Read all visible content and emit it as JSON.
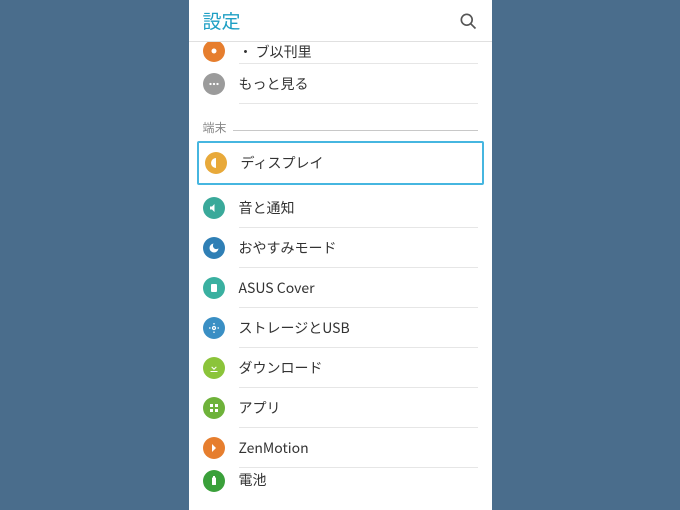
{
  "header": {
    "title": "設定"
  },
  "partialTop": {
    "label": "・  ブ以刊里",
    "iconColor": "#e67e2e"
  },
  "preSection": {
    "more": {
      "label": "もっと見る",
      "iconColor": "#9b9b9b"
    }
  },
  "section": {
    "label": "端末"
  },
  "items": [
    {
      "label": "ディスプレイ",
      "iconColor": "#e8a93a",
      "highlighted": true
    },
    {
      "label": "音と通知",
      "iconColor": "#3aa99a"
    },
    {
      "label": "おやすみモード",
      "iconColor": "#2f7fb5"
    },
    {
      "label": "ASUS Cover",
      "iconColor": "#3ab0a0"
    },
    {
      "label": "ストレージとUSB",
      "iconColor": "#3a8fc4"
    },
    {
      "label": "ダウンロード",
      "iconColor": "#8bc43a"
    },
    {
      "label": "アプリ",
      "iconColor": "#6eb23a"
    },
    {
      "label": "ZenMotion",
      "iconColor": "#e67e2e"
    }
  ],
  "partialBottom": {
    "label": "電池",
    "iconColor": "#3aa03a"
  }
}
